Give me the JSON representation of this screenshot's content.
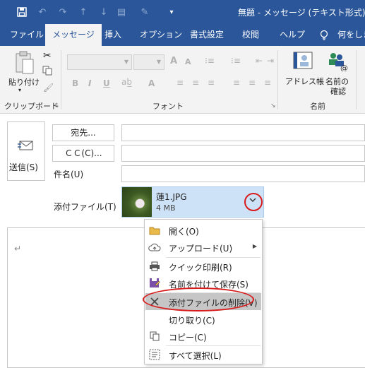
{
  "window": {
    "title": "無題 - メッセージ (テキスト形式)"
  },
  "quick_access": {
    "icons": [
      "save-icon",
      "undo-icon",
      "redo-icon",
      "up-arrow-icon",
      "down-arrow-icon",
      "format-icon",
      "signature-icon",
      "customize-icon"
    ]
  },
  "tabs": [
    {
      "label": "ファイル",
      "active": false
    },
    {
      "label": "メッセージ",
      "active": true
    },
    {
      "label": "挿入",
      "active": false
    },
    {
      "label": "オプション",
      "active": false
    },
    {
      "label": "書式設定",
      "active": false
    },
    {
      "label": "校閲",
      "active": false
    },
    {
      "label": "ヘルプ",
      "active": false
    },
    {
      "label": "何をしま",
      "active": false
    }
  ],
  "ribbon": {
    "paste_label": "貼り付け",
    "clipboard_group": "クリップボード",
    "font_group": "フォント",
    "address_book_label": "アドレス帳",
    "check_names_label_line1": "名前の",
    "check_names_label_line2": "確認",
    "names_group": "名前",
    "bold": "B",
    "italic": "I",
    "underline": "U",
    "grow_font": "A",
    "shrink_font": "A",
    "font_color": "A"
  },
  "compose": {
    "send_label": "送信(S)",
    "to_button": "宛先...",
    "cc_button": "ＣＣ(C)...",
    "subject_label": "件名(U)",
    "attachment_label": "添付ファイル(T)",
    "to_value": "",
    "cc_value": "",
    "subject_value": ""
  },
  "attachment": {
    "name": "蓮1.JPG",
    "size": "4 MB"
  },
  "context_menu": {
    "items": [
      {
        "label": "開く(O)",
        "icon": "folder-icon"
      },
      {
        "label": "アップロード(U)",
        "icon": "cloud-upload-icon"
      },
      {
        "label": "クイック印刷(R)",
        "icon": "printer-icon"
      },
      {
        "label": "名前を付けて保存(S)",
        "icon": "save-as-icon"
      },
      {
        "label": "添付ファイルの削除(V)",
        "icon": "delete-x-icon"
      },
      {
        "label": "切り取り(C)",
        "icon": ""
      },
      {
        "label": "コピー(C)",
        "icon": "copy-icon"
      },
      {
        "label": "すべて選択(L)",
        "icon": "select-all-icon"
      }
    ],
    "highlighted": "添付ファイルの削除(V)"
  },
  "colors": {
    "titlebar": "#2b579a",
    "ribbon_bg": "#f3f3f3",
    "attachment_chip": "#cde2f6",
    "highlight_circle": "#d81b1b",
    "menu_hover": "#c6c6c6"
  }
}
